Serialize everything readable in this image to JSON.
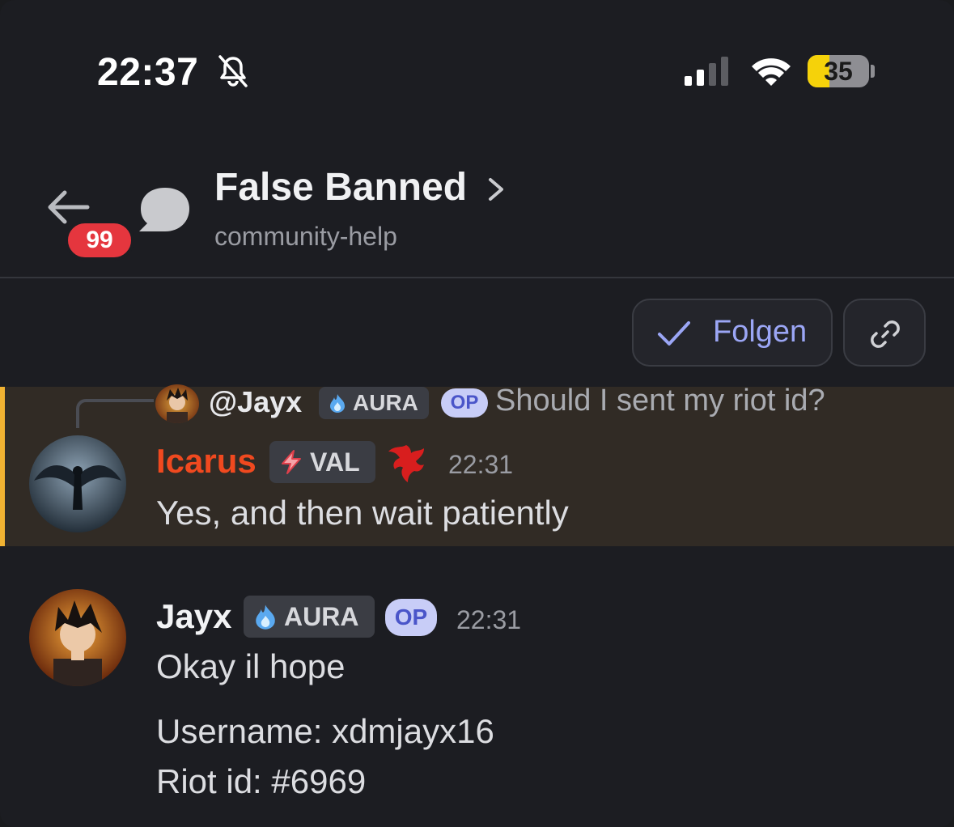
{
  "status_bar": {
    "time": "22:37",
    "battery_percent": "35",
    "battery_level": 0.35,
    "icons": [
      "bell-slash-icon",
      "cellular-signal-icon",
      "wifi-icon",
      "battery-icon"
    ]
  },
  "header": {
    "unread_count": "99",
    "thread_title": "False Banned",
    "channel": "community-help"
  },
  "actions": {
    "follow_label": "Folgen",
    "link_icon": "link-icon"
  },
  "messages": [
    {
      "reply": {
        "author": "@Jayx",
        "tag": "AURA",
        "op": "OP",
        "text": "Should I sent my riot id?"
      },
      "author": "Icarus",
      "author_color": "#f0491f",
      "tag": "VAL",
      "time": "22:31",
      "text": "Yes, and then wait patiently",
      "highlight_color": "#f0b232"
    },
    {
      "author": "Jayx",
      "tag": "AURA",
      "op": "OP",
      "time": "22:31",
      "lines": [
        "Okay il hope",
        "Username: xdmjayx16",
        "Riot id: #6969"
      ]
    }
  ],
  "colors": {
    "background": "#1c1d22",
    "accent": "#9ba6f5",
    "badge_red": "#e5363e"
  }
}
